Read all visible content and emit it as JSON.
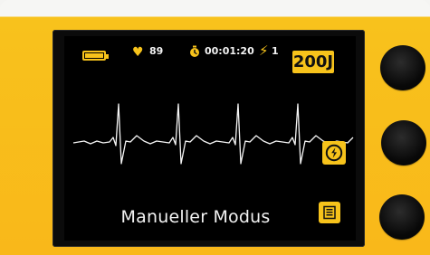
{
  "device": {
    "status": {
      "heart_rate": "89",
      "timer": "00:01:20",
      "shock_count": "1",
      "energy": "200J"
    },
    "main": {
      "mode_label": "Manueller Modus"
    },
    "icons": {
      "battery": "battery-icon",
      "heart": "heart-icon",
      "timer": "stopwatch-icon",
      "lightning": "lightning-icon",
      "shock": "shock-icon",
      "menu": "menu-icon"
    },
    "colors": {
      "accent": "#f7c31b",
      "screen": "#000000",
      "text": "#f2f2f2"
    }
  }
}
